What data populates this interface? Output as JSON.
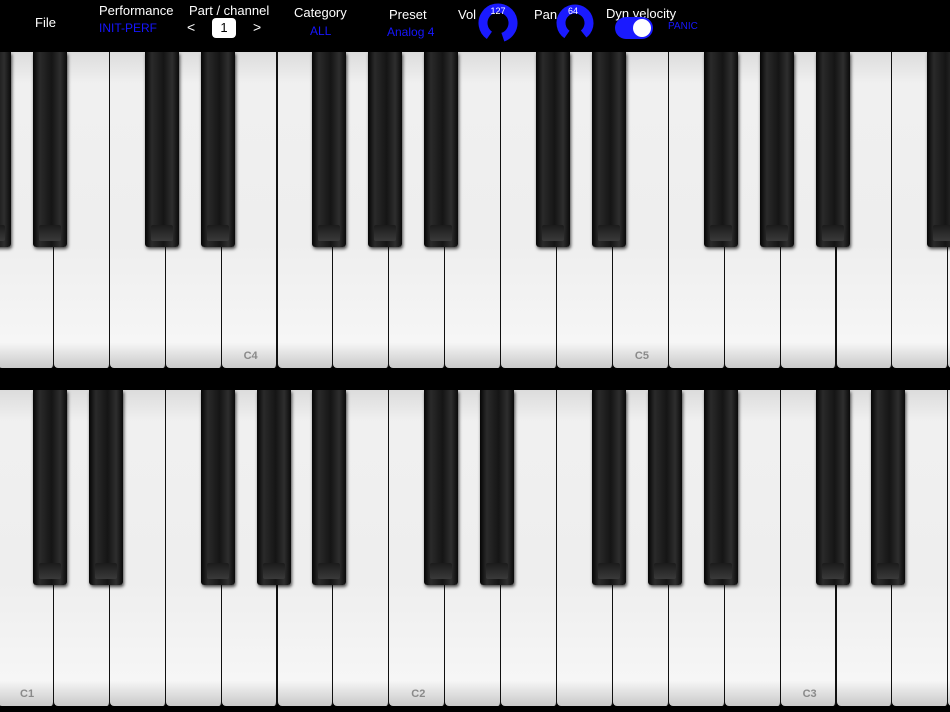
{
  "toolbar": {
    "file_label": "File",
    "performance_label": "Performance",
    "performance_value": "INIT-PERF",
    "part_label": "Part / channel",
    "prev_arrow": "<",
    "next_arrow": ">",
    "part_value": "1",
    "category_label": "Category",
    "category_value": "ALL",
    "preset_label": "Preset",
    "preset_value": "Analog 4",
    "vol_label": "Vol",
    "vol_value": "127",
    "pan_label": "Pan",
    "pan_value": "64",
    "dyn_label": "Dyn velocity",
    "dyn_on": true,
    "panic_label": "PANIC"
  },
  "colors": {
    "accent": "#1a1aff",
    "background": "#000000"
  },
  "keyboards": {
    "upper": {
      "labels": [
        "C4",
        "C5"
      ]
    },
    "lower": {
      "labels": [
        "C1",
        "C2",
        "C3"
      ]
    }
  }
}
